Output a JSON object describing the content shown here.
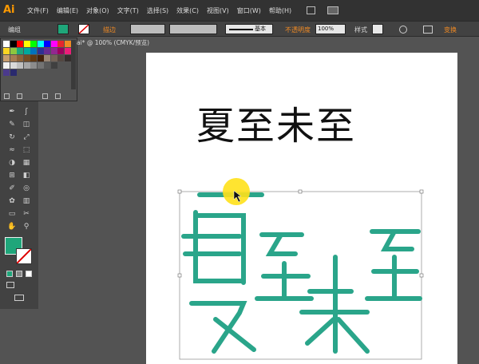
{
  "app": {
    "logo": "Ai"
  },
  "menu": [
    "文件(F)",
    "编辑(E)",
    "对象(O)",
    "文字(T)",
    "选择(S)",
    "效果(C)",
    "视图(V)",
    "窗口(W)",
    "帮助(H)"
  ],
  "control_bar": {
    "selection_label": "编组",
    "stroke_label": "描边",
    "stroke_style": "基本",
    "opacity_label": "不透明度",
    "opacity_value": "100%",
    "style_label": "样式",
    "transform_label": "变换"
  },
  "document_tab": {
    "label": "ai* @ 100% (CMYK/预览)"
  },
  "artwork": {
    "title_text": "夏至未至",
    "stroke_color": "#2aa58a"
  },
  "colors": {
    "fill": "#1fa67a",
    "highlight": "#ffe11a",
    "accent": "#f08a24"
  },
  "icons": {
    "tools": [
      "pen-icon",
      "brush-icon",
      "pencil-icon",
      "eraser-icon",
      "rotate-icon",
      "scale-icon",
      "width-icon",
      "free-transform-icon",
      "shape-builder-icon",
      "perspective-icon",
      "mesh-icon",
      "gradient-icon",
      "eyedropper-icon",
      "blend-icon",
      "symbol-icon",
      "graph-icon",
      "artboard-icon",
      "slice-icon",
      "hand-icon",
      "zoom-icon"
    ]
  }
}
